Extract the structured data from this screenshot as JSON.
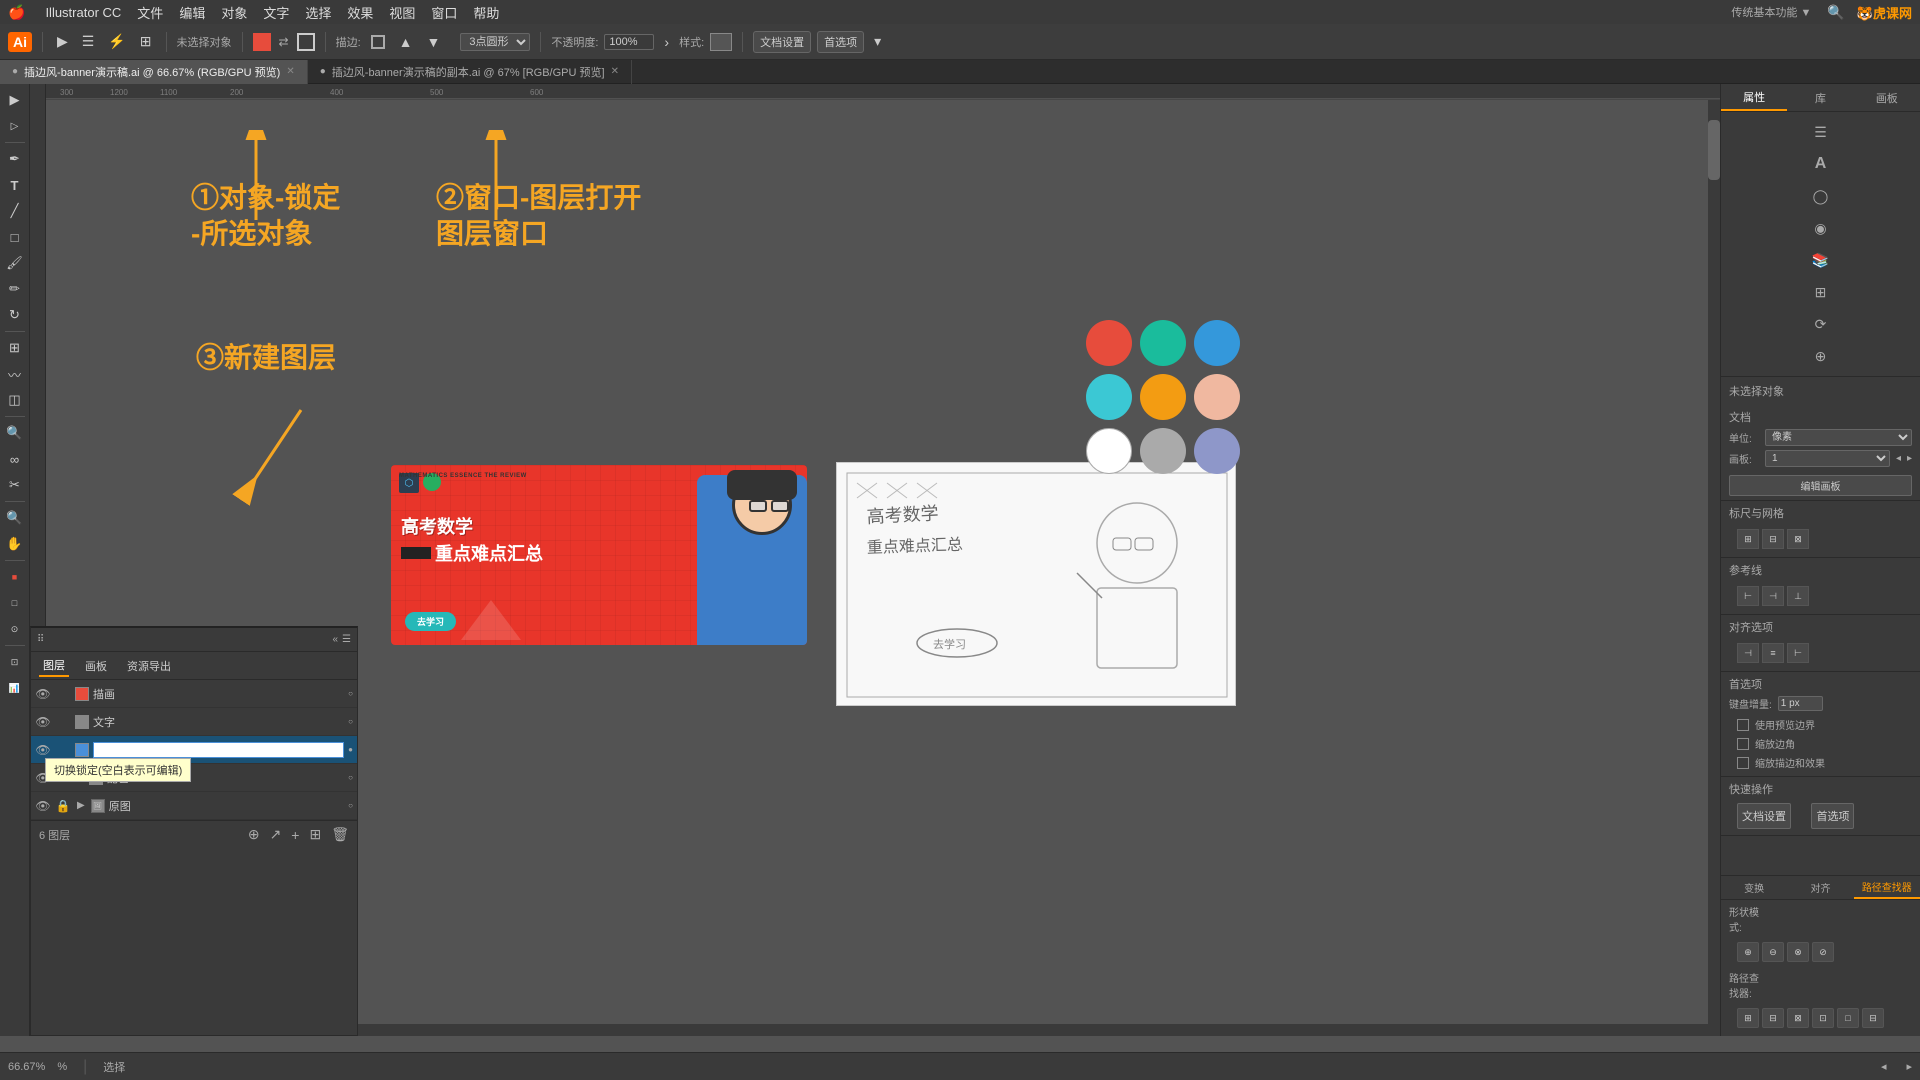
{
  "app": {
    "name": "Illustrator CC",
    "logo": "Ai",
    "version": "CC"
  },
  "menubar": {
    "apple": "🍎",
    "items": [
      "Illustrator CC",
      "文件",
      "编辑",
      "对象",
      "文字",
      "选择",
      "效果",
      "视图",
      "窗口",
      "帮助"
    ]
  },
  "toolbar": {
    "zoom_label": "66.67%",
    "tool_label": "未选择对象",
    "stroke_label": "描边:",
    "point_type": "3点圆形",
    "opacity_label": "不透明度:",
    "opacity_value": "100%",
    "style_label": "样式:",
    "doc_settings": "文档设置",
    "preferences": "首选项"
  },
  "tabs": [
    {
      "name": "插边风-banner演示稿.ai",
      "zoom": "66.67%",
      "mode": "RGB/GPU 预览",
      "active": true
    },
    {
      "name": "插边风-banner演示稿的副本.ai",
      "zoom": "67%",
      "mode": "RGB/GPU 预览",
      "active": false
    }
  ],
  "annotations": {
    "step1": "①对象-锁定\n-所选对象",
    "step1_line1": "①对象-锁定",
    "step1_line2": "-所选对象",
    "step2": "②窗口-图层打开",
    "step2_line1": "②窗口-图层打开",
    "step2_line2": "图层窗口",
    "step3": "③新建图层"
  },
  "layers_panel": {
    "tabs": [
      "图层",
      "画板",
      "资源导出"
    ],
    "layers": [
      {
        "name": "描画",
        "color": "#f00",
        "visible": true,
        "locked": false,
        "expanded": false
      },
      {
        "name": "文字",
        "color": "#888",
        "visible": true,
        "locked": false,
        "expanded": false
      },
      {
        "name": "",
        "color": "#4a90d9",
        "visible": true,
        "locked": false,
        "expanded": false,
        "selected": true,
        "editing": true
      },
      {
        "name": "配色",
        "color": "#888",
        "visible": true,
        "locked": false,
        "expanded": true
      },
      {
        "name": "原图",
        "color": "#888",
        "visible": true,
        "locked": true,
        "expanded": false
      }
    ],
    "count_label": "6 图层",
    "tooltip": "切换锁定(空白表示可编辑)"
  },
  "right_panel": {
    "tabs": [
      "属性",
      "库",
      "画板"
    ],
    "title": "未选择对象",
    "section_doc": "文档",
    "unit_label": "单位:",
    "unit_value": "像素",
    "board_label": "画板:",
    "board_value": "1",
    "edit_board_btn": "编辑画板",
    "align_title": "标尺与网格",
    "guides_title": "参考线",
    "align_objects_title": "对齐选项",
    "preferences_title": "首选项",
    "key_inc_label": "键盘增量:",
    "key_inc_value": "1 px",
    "snap_bounds_label": "使用预览边界",
    "corner_label": "缩放边角",
    "scale_label": "缩放描边和效果",
    "quick_actions_title": "快速操作",
    "doc_settings_btn": "文档设置",
    "preferences_btn": "首选项",
    "path_finder_title": "路径查找器",
    "shape_modes_label": "形状模式:",
    "path_finder_label": "路径查找器:"
  },
  "colors": {
    "swatch1": "#e74c3c",
    "swatch2": "#1abc9c",
    "swatch3": "#3498db",
    "swatch4": "#3bc8d4",
    "swatch5": "#f39c12",
    "swatch6": "#f0b8a0",
    "swatch7": "#ffffff",
    "swatch8": "#aaaaaa",
    "swatch9": "#8e97c9"
  },
  "statusbar": {
    "zoom": "66.67%",
    "tool": "选择"
  },
  "watermark": "🐯虎课网",
  "banner": {
    "subtitle": "MATHEMATICS ESSENCE THE REVIEW",
    "title_line1": "高考数学",
    "title_line2": "重点难点汇总",
    "button": "去学习"
  }
}
